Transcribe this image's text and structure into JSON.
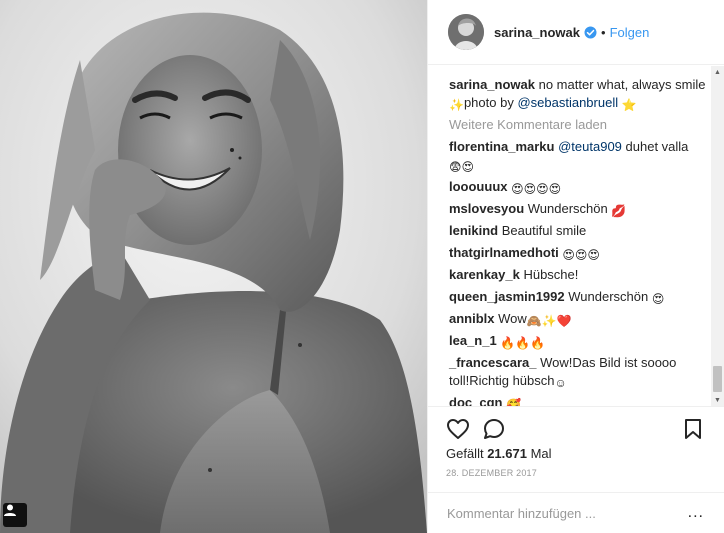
{
  "header": {
    "username": "sarina_nowak",
    "separator": "•",
    "follow_label": "Folgen"
  },
  "caption": {
    "user": "sarina_nowak",
    "text": " no matter what, always smile ",
    "text_2": "photo by ",
    "mention": "@sebastianbruell",
    "emoji_sparkle": "✨",
    "emoji_star": "⭐"
  },
  "load_more_label": "Weitere Kommentare laden",
  "comments": [
    {
      "user": "florentina_marku",
      "text_before": " ",
      "mention": "@teuta909",
      "text": " duhet valla ",
      "emoji": "😨😍"
    },
    {
      "user": "looouuux",
      "text": " ",
      "emoji": "😍😍😍😍"
    },
    {
      "user": "mslovesyou",
      "text": " Wunderschön ",
      "emoji": "💋"
    },
    {
      "user": "lenikind",
      "text": " Beautiful smile",
      "emoji": ""
    },
    {
      "user": "thatgirlnamedhoti",
      "text": " ",
      "emoji": "😍😍😍"
    },
    {
      "user": "karenkay_k",
      "text": " Hübsche!",
      "emoji": ""
    },
    {
      "user": "queen_jasmin1992",
      "text": " Wunderschön ",
      "emoji": "😍"
    },
    {
      "user": "anniblx",
      "text": " Wow",
      "emoji": "🙈✨❤️"
    },
    {
      "user": "lea_n_1",
      "text": " ",
      "emoji": "🔥🔥🔥"
    },
    {
      "user": "_francescara_",
      "text": " Wow!Das Bild ist soooo toll!Richtig hübsch",
      "emoji": "☺"
    },
    {
      "user": "doc_cgn",
      "text": " ",
      "emoji": "🥰"
    }
  ],
  "likes": {
    "label": "Gefällt ",
    "count": "21.671",
    "suffix": " Mal"
  },
  "date": "28. DEZEMBER 2017",
  "add_comment": {
    "placeholder": "Kommentar hinzufügen ...",
    "more_label": "..."
  },
  "icons": {
    "like": "heart-icon",
    "comment": "comment-icon",
    "save": "bookmark-icon",
    "verified": "verified-badge-icon",
    "tag": "user-tag-icon"
  },
  "colors": {
    "link": "#3897f0",
    "mention": "#003569",
    "muted": "#999999",
    "text": "#262626",
    "border": "#efefef"
  }
}
